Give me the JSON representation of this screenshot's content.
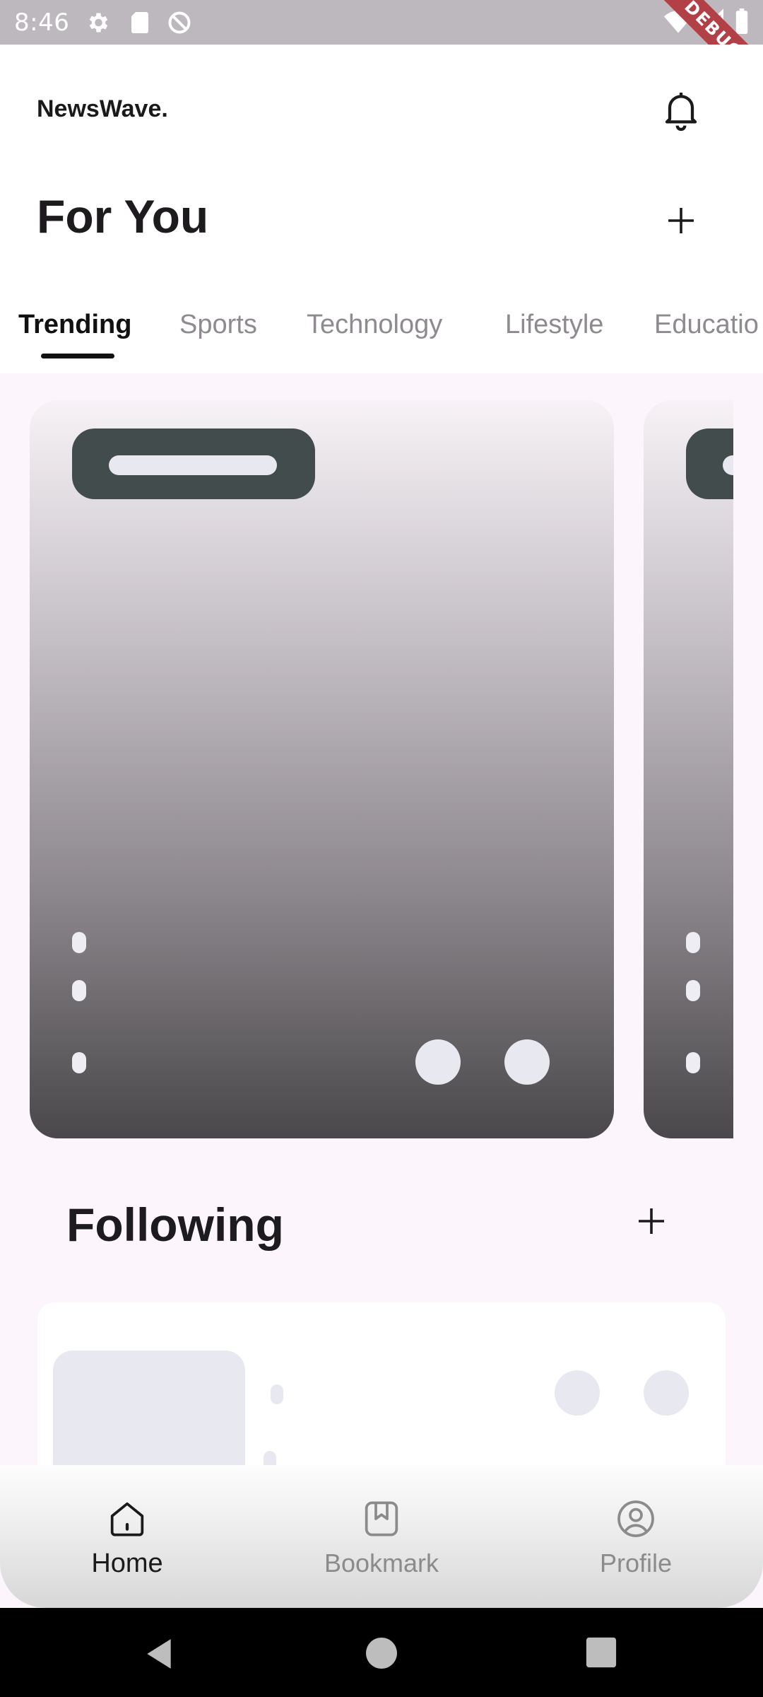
{
  "status_bar": {
    "time": "8:46",
    "left_icons": [
      "gear-icon",
      "sd-card-icon",
      "do-not-disturb-icon"
    ],
    "right_icons": [
      "wifi-icon",
      "signal-icon",
      "battery-icon"
    ],
    "debug_label": "DEBUG"
  },
  "header": {
    "brand": "NewsWave.",
    "notification_icon": "bell-icon"
  },
  "for_you": {
    "title": "For You",
    "add_icon": "plus-icon"
  },
  "tabs": [
    {
      "label": "Trending",
      "active": true
    },
    {
      "label": "Sports",
      "active": false
    },
    {
      "label": "Technology",
      "active": false
    },
    {
      "label": "Lifestyle",
      "active": false
    },
    {
      "label": "Educatio",
      "active": false
    }
  ],
  "following": {
    "title": "Following",
    "add_icon": "plus-icon"
  },
  "bottom_nav": [
    {
      "label": "Home",
      "icon": "home-icon",
      "active": true
    },
    {
      "label": "Bookmark",
      "icon": "bookmark-icon",
      "active": false
    },
    {
      "label": "Profile",
      "icon": "profile-icon",
      "active": false
    }
  ],
  "system_nav": [
    "back-icon",
    "home-circle-icon",
    "recents-icon"
  ],
  "colors": {
    "background": "#FCF6FC",
    "ink": "#1E1B1E",
    "muted": "#8E8A90",
    "skeleton": "#E8E8F0",
    "badge": "#424C4D",
    "debug": "#B24047"
  }
}
